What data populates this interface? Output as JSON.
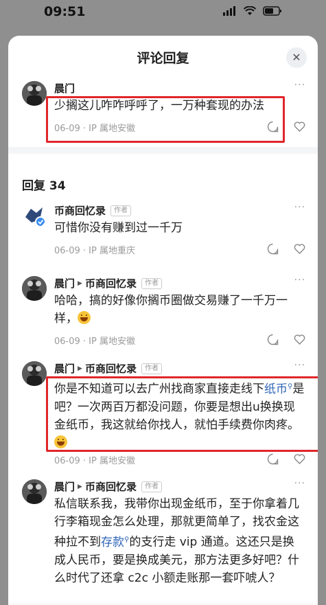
{
  "status_bar": {
    "time": "09:51"
  },
  "sheet": {
    "title": "评论回复",
    "close_icon": "close-icon"
  },
  "main_comment": {
    "author": "晨门",
    "text": "少搁这儿咋咋呼呼了，一万种套现的办法",
    "meta": "06-09 · IP 属地安徽"
  },
  "replies_header": "回复 34",
  "replies": [
    {
      "author": "币商回忆录",
      "author_tag": "作者",
      "text": "可惜你没有赚到过一千万",
      "meta": "06-09 · IP 属地重庆"
    },
    {
      "author": "晨门",
      "reply_to": "币商回忆录",
      "reply_to_tag": "作者",
      "text": "哈哈，搞的好像你搁币圈做交易赚了一千万一样，",
      "meta": "06-09 · IP 属地安徽"
    },
    {
      "author": "晨门",
      "reply_to": "币商回忆录",
      "reply_to_tag": "作者",
      "text_part1": "你是不知道可以去广州找商家直接走线下",
      "link1": "纸币",
      "text_part2": "是吧？一次两百万都没问题，你要是想出u换换现金纸币，我这就给你找人，就怕手续费你肉疼。",
      "meta": "06-09 · IP 属地安徽"
    },
    {
      "author": "晨门",
      "reply_to": "币商回忆录",
      "reply_to_tag": "作者",
      "text_part1": "私信联系我，我带你出现金纸币，至于你拿着几行李箱现金怎么处理，那就更简单了，找农金这种拉不到",
      "link1": "存款",
      "text_part2": "的支行走 vip 通道。这还只是换成人民币，要是换成美元，那方法更多好吧？什么时代了还拿 c2c 小额走账那一套吓唬人？"
    }
  ]
}
